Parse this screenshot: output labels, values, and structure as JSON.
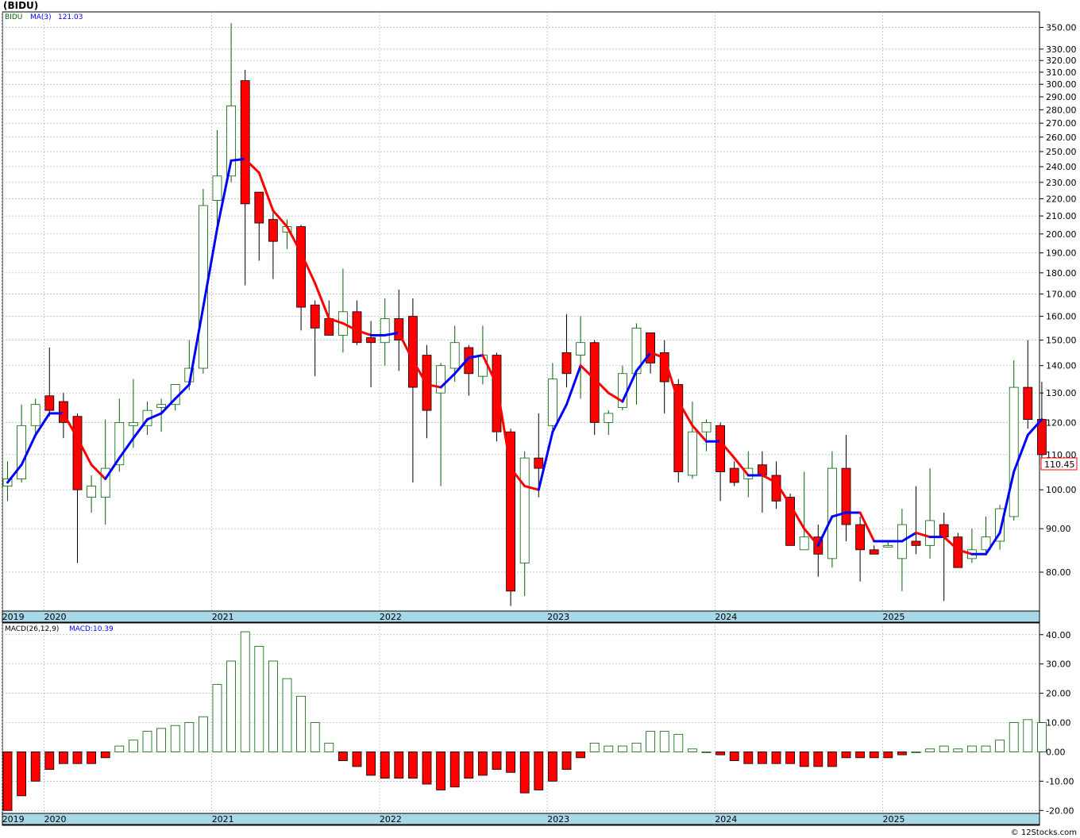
{
  "page": {
    "title": "(BIDU)",
    "copyright": "© 12Stocks.com"
  },
  "price_legend": {
    "symbol": "BIDU",
    "ma_label": "MA(3)",
    "ma_value": "121.03",
    "last_price_label": "110.45"
  },
  "macd_legend": {
    "label": "MACD(26,12,9)",
    "value_label": "MACD:10.39"
  },
  "colors": {
    "up": "#006400",
    "down": "#ff0000",
    "ma_rising": "#0000ff",
    "ma_falling": "#ff0000",
    "year_strip": "#a8d8e8",
    "grid": "#b0b0b0"
  },
  "chart_data": [
    {
      "type": "candlestick",
      "interval": "monthly",
      "scale": "log",
      "ylim": [
        72,
        365
      ],
      "yticks": [
        80,
        90,
        100,
        110,
        120,
        130,
        140,
        150,
        160,
        170,
        180,
        190,
        200,
        210,
        220,
        230,
        240,
        250,
        260,
        270,
        280,
        290,
        300,
        310,
        320,
        330,
        350
      ],
      "year_labels": [
        "2019",
        "2020",
        "2021",
        "2022",
        "2023",
        "2024",
        "2025"
      ],
      "year_first_index": {
        "2019": 0,
        "2020": 3,
        "2021": 15,
        "2022": 27,
        "2023": 39,
        "2024": 51,
        "2025": 63
      },
      "candles": [
        {
          "o": 101,
          "h": 108,
          "l": 97,
          "c": 103
        },
        {
          "o": 103,
          "h": 126,
          "l": 102,
          "c": 119
        },
        {
          "o": 119,
          "h": 128,
          "l": 116,
          "c": 126
        },
        {
          "o": 129,
          "h": 147,
          "l": 122,
          "c": 124
        },
        {
          "o": 127,
          "h": 130,
          "l": 115,
          "c": 120
        },
        {
          "o": 122,
          "h": 123,
          "l": 82,
          "c": 100
        },
        {
          "o": 98,
          "h": 104,
          "l": 94,
          "c": 101
        },
        {
          "o": 98,
          "h": 121,
          "l": 91,
          "c": 106
        },
        {
          "o": 107,
          "h": 128,
          "l": 105,
          "c": 120
        },
        {
          "o": 119,
          "h": 135,
          "l": 112,
          "c": 120
        },
        {
          "o": 119,
          "h": 127,
          "l": 116,
          "c": 124
        },
        {
          "o": 125,
          "h": 128,
          "l": 117,
          "c": 126
        },
        {
          "o": 126,
          "h": 130,
          "l": 124,
          "c": 133
        },
        {
          "o": 134,
          "h": 150,
          "l": 131,
          "c": 139
        },
        {
          "o": 139,
          "h": 226,
          "l": 137,
          "c": 216
        },
        {
          "o": 219,
          "h": 265,
          "l": 203,
          "c": 234
        },
        {
          "o": 234,
          "h": 354,
          "l": 230,
          "c": 283
        },
        {
          "o": 303,
          "h": 312,
          "l": 174,
          "c": 217
        },
        {
          "o": 224,
          "h": 224,
          "l": 186,
          "c": 206
        },
        {
          "o": 208,
          "h": 212,
          "l": 177,
          "c": 196
        },
        {
          "o": 201,
          "h": 208,
          "l": 192,
          "c": 204
        },
        {
          "o": 204,
          "h": 205,
          "l": 154,
          "c": 164
        },
        {
          "o": 165,
          "h": 167,
          "l": 136,
          "c": 155
        },
        {
          "o": 159,
          "h": 167,
          "l": 153,
          "c": 152
        },
        {
          "o": 152,
          "h": 182,
          "l": 145,
          "c": 162
        },
        {
          "o": 162,
          "h": 167,
          "l": 148,
          "c": 149
        },
        {
          "o": 151,
          "h": 158,
          "l": 132,
          "c": 149
        },
        {
          "o": 149,
          "h": 168,
          "l": 140,
          "c": 159
        },
        {
          "o": 159,
          "h": 172,
          "l": 138,
          "c": 150
        },
        {
          "o": 160,
          "h": 168,
          "l": 102,
          "c": 132
        },
        {
          "o": 144,
          "h": 148,
          "l": 115,
          "c": 124
        },
        {
          "o": 130,
          "h": 141,
          "l": 101,
          "c": 140
        },
        {
          "o": 139,
          "h": 156,
          "l": 134,
          "c": 149
        },
        {
          "o": 147,
          "h": 148,
          "l": 129,
          "c": 137
        },
        {
          "o": 136,
          "h": 156,
          "l": 133,
          "c": 144
        },
        {
          "o": 144,
          "h": 145,
          "l": 114,
          "c": 117
        },
        {
          "o": 117,
          "h": 118,
          "l": 73,
          "c": 76
        },
        {
          "o": 82,
          "h": 111,
          "l": 75,
          "c": 109
        },
        {
          "o": 109,
          "h": 123,
          "l": 98,
          "c": 106
        },
        {
          "o": 119,
          "h": 141,
          "l": 117,
          "c": 135
        },
        {
          "o": 145,
          "h": 161,
          "l": 132,
          "c": 137
        },
        {
          "o": 144,
          "h": 160,
          "l": 128,
          "c": 149
        },
        {
          "o": 149,
          "h": 150,
          "l": 116,
          "c": 120
        },
        {
          "o": 120,
          "h": 124,
          "l": 116,
          "c": 123
        },
        {
          "o": 125,
          "h": 140,
          "l": 124,
          "c": 137
        },
        {
          "o": 137,
          "h": 157,
          "l": 126,
          "c": 155
        },
        {
          "o": 153,
          "h": 150,
          "l": 137,
          "c": 141
        },
        {
          "o": 145,
          "h": 150,
          "l": 123,
          "c": 134
        },
        {
          "o": 133,
          "h": 135,
          "l": 102,
          "c": 105
        },
        {
          "o": 104,
          "h": 127,
          "l": 103,
          "c": 117
        },
        {
          "o": 117,
          "h": 121,
          "l": 111,
          "c": 120
        },
        {
          "o": 119,
          "h": 120,
          "l": 97,
          "c": 105
        },
        {
          "o": 106,
          "h": 108,
          "l": 101,
          "c": 102
        },
        {
          "o": 103,
          "h": 111,
          "l": 98,
          "c": 106
        },
        {
          "o": 107,
          "h": 111,
          "l": 94,
          "c": 104
        },
        {
          "o": 104,
          "h": 108,
          "l": 95,
          "c": 97
        },
        {
          "o": 98,
          "h": 99,
          "l": 86,
          "c": 86
        },
        {
          "o": 85,
          "h": 105,
          "l": 85,
          "c": 88
        },
        {
          "o": 88,
          "h": 91,
          "l": 79,
          "c": 84
        },
        {
          "o": 83,
          "h": 111,
          "l": 81,
          "c": 106
        },
        {
          "o": 106,
          "h": 116,
          "l": 87,
          "c": 91
        },
        {
          "o": 91,
          "h": 93,
          "l": 78,
          "c": 85
        },
        {
          "o": 85,
          "h": 86,
          "l": 84,
          "c": 84
        },
        {
          "o": 86,
          "h": 87,
          "l": 86,
          "c": 86
        },
        {
          "o": 83,
          "h": 95,
          "l": 76,
          "c": 91
        },
        {
          "o": 87,
          "h": 101,
          "l": 84,
          "c": 86
        },
        {
          "o": 86,
          "h": 106,
          "l": 83,
          "c": 92
        },
        {
          "o": 91,
          "h": 94,
          "l": 74,
          "c": 88
        },
        {
          "o": 88,
          "h": 89,
          "l": 81,
          "c": 81
        },
        {
          "o": 83,
          "h": 90,
          "l": 82,
          "c": 85
        },
        {
          "o": 85,
          "h": 93,
          "l": 84,
          "c": 88
        },
        {
          "o": 87,
          "h": 96,
          "l": 85,
          "c": 95
        },
        {
          "o": 93,
          "h": 142,
          "l": 92,
          "c": 132
        },
        {
          "o": 132,
          "h": 150,
          "l": 118,
          "c": 121
        },
        {
          "o": 121,
          "h": 134,
          "l": 108,
          "c": 110
        }
      ],
      "ma3": [
        102,
        107,
        116,
        123,
        123,
        115,
        107,
        103,
        109,
        115,
        121,
        123,
        128,
        133,
        164,
        203,
        244,
        245,
        236,
        213,
        204,
        190,
        175,
        159,
        157,
        154,
        152,
        152,
        153,
        142,
        133,
        132,
        137,
        143,
        144,
        133,
        106,
        101,
        100,
        117,
        126,
        140,
        135,
        130,
        127,
        138,
        145,
        143,
        127,
        119,
        114,
        114,
        109,
        104,
        104,
        102,
        96,
        90,
        86,
        93,
        94,
        94,
        87,
        87,
        87,
        89,
        88,
        88,
        85,
        84,
        84,
        89,
        105,
        116,
        121
      ],
      "macd_ylim": [
        -21,
        44
      ],
      "macd_yticks": [
        -20,
        -10,
        0,
        10,
        20,
        30,
        40
      ],
      "macd_hist": [
        -20,
        -15,
        -10,
        -6,
        -4,
        -4,
        -4,
        -2,
        2,
        4,
        7,
        8,
        9,
        10,
        12,
        23,
        31,
        41,
        36,
        31,
        25,
        19,
        10,
        3,
        -3,
        -5,
        -8,
        -9,
        -9,
        -9,
        -11,
        -13,
        -12,
        -9,
        -8,
        -6,
        -7,
        -14,
        -13,
        -10,
        -6,
        -2,
        3,
        2,
        2,
        3,
        7,
        7,
        6,
        1,
        0,
        -1,
        -3,
        -4,
        -4,
        -4,
        -4,
        -5,
        -5,
        -5,
        -2,
        -2,
        -2,
        -2,
        -1,
        0,
        1,
        2,
        1,
        2,
        2,
        4,
        10,
        11,
        10
      ]
    }
  ]
}
